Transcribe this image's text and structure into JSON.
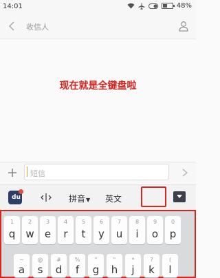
{
  "status_bar": {
    "time": "14:01",
    "battery_percent": "48%",
    "battery_level": 0.48
  },
  "header": {
    "title": "收信人",
    "icons": [
      "back-chevron-icon",
      "contact-person-icon"
    ]
  },
  "caption": "现在就是全键盘啦",
  "compose": {
    "placeholder": "短信",
    "icons": [
      "add-icon",
      "send-icon"
    ]
  },
  "ime_toolbar": {
    "pinyin_label": "拼音",
    "english_label": "英文",
    "icons": [
      "ime-logo-icon",
      "cursor-move-icon",
      "keyboard-hide-icon"
    ]
  },
  "keyboard": {
    "row1": [
      {
        "sym": "1",
        "ch": "q"
      },
      {
        "sym": "2",
        "ch": "w"
      },
      {
        "sym": "3",
        "ch": "e"
      },
      {
        "sym": "4",
        "ch": "r"
      },
      {
        "sym": "5",
        "ch": "t"
      },
      {
        "sym": "6",
        "ch": "y"
      },
      {
        "sym": "7",
        "ch": "u"
      },
      {
        "sym": "8",
        "ch": "i"
      },
      {
        "sym": "9",
        "ch": "o"
      },
      {
        "sym": "0",
        "ch": "p"
      }
    ],
    "row2": [
      {
        "sym": "~",
        "ch": "a"
      },
      {
        "sym": "@",
        "ch": "s"
      },
      {
        "sym": "#",
        "ch": "d"
      },
      {
        "sym": "%",
        "ch": "f"
      },
      {
        "sym": "\"",
        "ch": "g"
      },
      {
        "sym": "\"",
        "ch": "h"
      },
      {
        "sym": "*",
        "ch": "j"
      },
      {
        "sym": "?",
        "ch": "k"
      },
      {
        "sym": "(",
        "ch": "l"
      }
    ]
  },
  "colors": {
    "highlight": "#d62620",
    "caption": "#d62620",
    "ime_logo": "#2c3e66"
  }
}
